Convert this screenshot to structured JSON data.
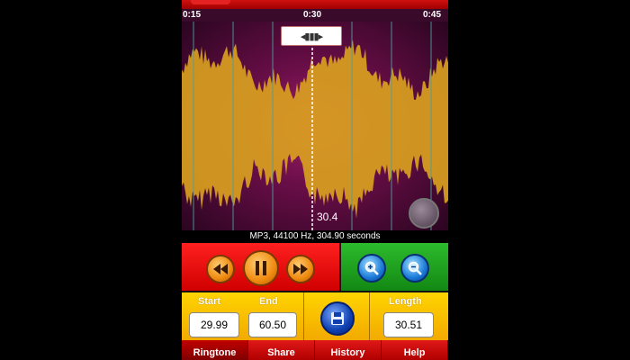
{
  "timeline": {
    "ticks": [
      "0:15",
      "0:30",
      "0:45"
    ]
  },
  "waveform": {
    "playhead_value": "30.4",
    "handle_icon": "drag-handle-icon"
  },
  "info": {
    "text": "MP3, 44100 Hz, 304.90 seconds"
  },
  "transport": {
    "rewind_icon": "rewind-icon",
    "pause_icon": "pause-icon",
    "forward_icon": "fast-forward-icon"
  },
  "zoom": {
    "zoom_in_icon": "zoom-in-icon",
    "zoom_out_icon": "zoom-out-icon"
  },
  "fields": {
    "start_label": "Start",
    "start_value": "29.99",
    "end_label": "End",
    "end_value": "60.50",
    "length_label": "Length",
    "length_value": "30.51",
    "save_icon": "save-icon"
  },
  "tabs": [
    {
      "label": "Ringtone",
      "active": true
    },
    {
      "label": "Share",
      "active": false
    },
    {
      "label": "History",
      "active": false
    },
    {
      "label": "Help",
      "active": false
    }
  ],
  "colors": {
    "transport_bg": "#e00000",
    "zoom_bg": "#1a9a1a",
    "fields_bg": "#f5b800",
    "waveform_fill": "#d9a020",
    "waveform_bg": "#7a1050"
  }
}
